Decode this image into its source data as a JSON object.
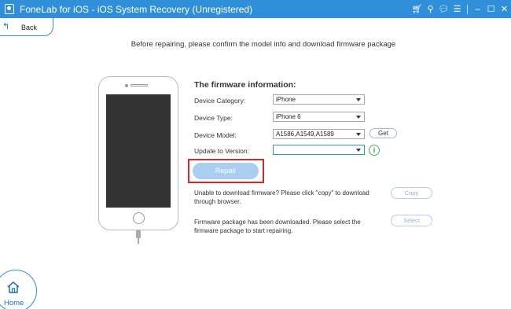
{
  "window": {
    "title": "FoneLab for iOS - iOS System Recovery (Unregistered)",
    "icons": [
      "cart-icon",
      "key-icon",
      "chat-icon",
      "menu-icon",
      "minimize-icon",
      "maximize-icon",
      "close-icon"
    ]
  },
  "nav": {
    "back_label": "Back",
    "home_label": "Home"
  },
  "headline": "Before repairing, please confirm the model info and download firmware package",
  "firmware": {
    "heading": "The firmware information:",
    "fields": [
      {
        "label": "Device Category:",
        "value": "iPhone"
      },
      {
        "label": "Device Type:",
        "value": "iPhone 6"
      },
      {
        "label": "Device Model:",
        "value": "A1586,A1549,A1589"
      },
      {
        "label": "Update to Version:",
        "value": ""
      }
    ],
    "get_label": "Get"
  },
  "repair": {
    "label": "Repair"
  },
  "download_note": {
    "text": "Unable to download firmware? Please click \"copy\" to download through browser.",
    "button": "Copy"
  },
  "select_note": {
    "text": "Firmware package has been downloaded. Please select the firmware package to start repairing.",
    "button": "Select"
  },
  "colors": {
    "titlebar": "#2f8fd8",
    "highlight": "#d9262b",
    "repair_button": "#a9cef0"
  }
}
